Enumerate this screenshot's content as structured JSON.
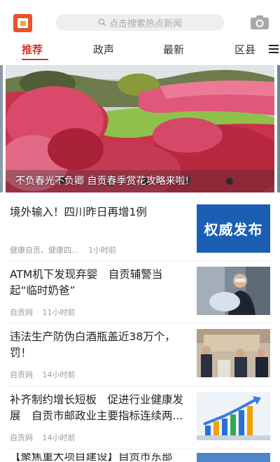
{
  "header": {
    "search_placeholder": "点击搜索热点新闻",
    "logo_icon": "app-logo",
    "camera_icon": "camera-icon"
  },
  "tabs": [
    {
      "label": "推荐",
      "active": true
    },
    {
      "label": "政声",
      "active": false
    },
    {
      "label": "最新",
      "active": false
    },
    {
      "label": "区县",
      "active": false
    }
  ],
  "hero": {
    "caption": "不负春光不负卿 自贡春季赏花攻略来啦!"
  },
  "news": [
    {
      "title": "境外输入！四川昨日再增1例",
      "source": "健康自贡、健康四...",
      "time": "1小时前",
      "thumb_text": "权威发布"
    },
    {
      "title": "ATM机下发现弃婴　自贡辅警当起“临时奶爸”",
      "source": "自贡网",
      "time": "11小时前"
    },
    {
      "title": "违法生产防伪白酒瓶盖近38万个，罚！",
      "source": "自贡网",
      "time": "14小时前"
    },
    {
      "title": "补齐制约增长短板　促进行业健康发展　自贡市邮政业主要指标连续两...",
      "source": "自贡网",
      "time": "14小时前"
    },
    {
      "title": "【聚焦重大项目建设】自贡市东部"
    }
  ],
  "colors": {
    "accent": "#d23a30",
    "badge_blue": "#1a5fb4"
  }
}
